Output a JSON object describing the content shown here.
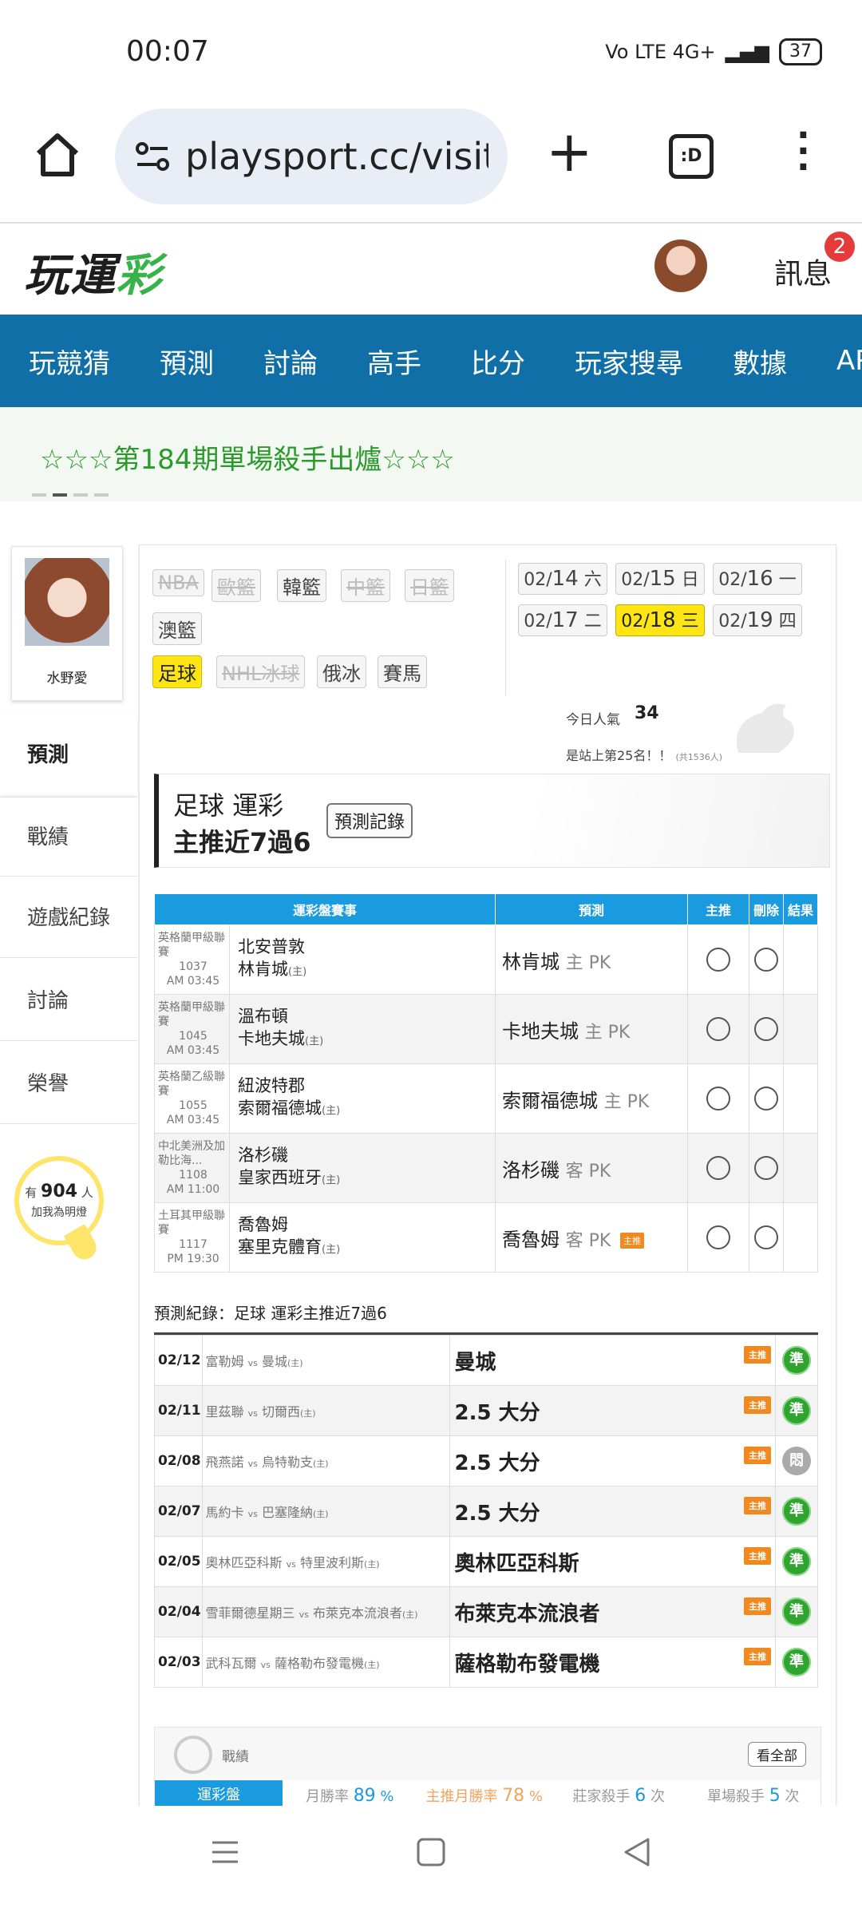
{
  "status_bar": {
    "time": "00:07",
    "network": "Vo LTE 4G+",
    "battery": "37"
  },
  "browser": {
    "url": "playsport.cc/visit",
    "tabs_label": ":D"
  },
  "site": {
    "logo_part1": "玩運",
    "logo_part2": "彩",
    "messages_label": "訊息",
    "messages_badge": "2"
  },
  "nav": [
    "玩競猜",
    "預測",
    "討論",
    "高手",
    "比分",
    "玩家搜尋",
    "數據",
    "APP"
  ],
  "banner": {
    "text": "☆☆☆第184期單場殺手出爐☆☆☆"
  },
  "sidebar": {
    "profile_name": "水野愛",
    "items": [
      "預測",
      "戰績",
      "遊戲紀錄",
      "討論",
      "榮譽"
    ],
    "bulb_prefix": "有",
    "bulb_count": "904",
    "bulb_suffix": "人",
    "bulb_line2": "加我為明燈"
  },
  "sports": {
    "row1": [
      "NBA",
      "歐籃",
      "韓籃",
      "中籃",
      "日籃"
    ],
    "row2": [
      "澳籃"
    ],
    "row3": [
      "足球",
      "NHL冰球",
      "俄冰",
      "賽馬"
    ]
  },
  "dates": [
    {
      "md": "02/",
      "d": "14",
      "w": "六"
    },
    {
      "md": "02/",
      "d": "15",
      "w": "日"
    },
    {
      "md": "02/",
      "d": "16",
      "w": "一"
    },
    {
      "md": "02/",
      "d": "17",
      "w": "二"
    },
    {
      "md": "02/",
      "d": "18",
      "w": "三"
    },
    {
      "md": "02/",
      "d": "19",
      "w": "四"
    }
  ],
  "popularity": {
    "label": "今日人氣",
    "value": "34",
    "rank": "是站上第25名！！",
    "rank_note": "(共1536人)"
  },
  "title": {
    "line1": "足球 運彩",
    "line2": "主推近7過6",
    "record_btn": "預測記錄"
  },
  "table": {
    "headers": [
      "運彩盤賽事",
      "預測",
      "主推",
      "刪除",
      "結果"
    ],
    "rows": [
      {
        "league": "英格蘭甲級聯賽",
        "no": "1037",
        "time": "AM 03:45",
        "away": "北安普敦",
        "home": "林肯城",
        "home_tag": "(主)",
        "pick": "林肯城",
        "side": "主 PK",
        "tag": ""
      },
      {
        "league": "英格蘭甲級聯賽",
        "no": "1045",
        "time": "AM 03:45",
        "away": "溫布頓",
        "home": "卡地夫城",
        "home_tag": "(主)",
        "pick": "卡地夫城",
        "side": "主 PK",
        "tag": ""
      },
      {
        "league": "英格蘭乙級聯賽",
        "no": "1055",
        "time": "AM 03:45",
        "away": "紐波特郡",
        "home": "索爾福德城",
        "home_tag": "(主)",
        "pick": "索爾福德城",
        "side": "主 PK",
        "tag": ""
      },
      {
        "league": "中北美洲及加勒比海...",
        "no": "1108",
        "time": "AM 11:00",
        "away": "洛杉磯",
        "home": "皇家西班牙",
        "home_tag": "(主)",
        "pick": "洛杉磯",
        "side": "客 PK",
        "tag": ""
      },
      {
        "league": "土耳其甲級聯賽",
        "no": "1117",
        "time": "PM 19:30",
        "away": "喬魯姆",
        "home": "塞里克體育",
        "home_tag": "(主)",
        "pick": "喬魯姆",
        "side": "客 PK",
        "tag": "主推"
      }
    ]
  },
  "record": {
    "title": "預測紀錄：足球 運彩主推近7過6",
    "vs": "vs",
    "rows": [
      {
        "date": "02/12",
        "away": "富勒姆",
        "home": "曼城",
        "home_tag": "(主)",
        "pick": "曼城",
        "tag": "主推",
        "result": "準",
        "win": true
      },
      {
        "date": "02/11",
        "away": "里茲聯",
        "home": "切爾西",
        "home_tag": "(主)",
        "pick": "2.5 大分",
        "tag": "主推",
        "result": "準",
        "win": true
      },
      {
        "date": "02/08",
        "away": "飛燕諾",
        "home": "烏特勒支",
        "home_tag": "(主)",
        "pick": "2.5 大分",
        "tag": "主推",
        "result": "悶",
        "win": false
      },
      {
        "date": "02/07",
        "away": "馬約卡",
        "home": "巴塞隆納",
        "home_tag": "(主)",
        "pick": "2.5 大分",
        "tag": "主推",
        "result": "準",
        "win": true
      },
      {
        "date": "02/05",
        "away": "奧林匹亞科斯",
        "home": "特里波利斯",
        "home_tag": "(主)",
        "pick": "奧林匹亞科斯",
        "tag": "主推",
        "result": "準",
        "win": true
      },
      {
        "date": "02/04",
        "away": "雪菲爾德星期三",
        "home": "布萊克本流浪者",
        "home_tag": "(主)",
        "pick": "布萊克本流浪者",
        "tag": "主推",
        "result": "準",
        "win": true
      },
      {
        "date": "02/03",
        "away": "武科瓦爾",
        "home": "薩格勒布發電機",
        "home_tag": "(主)",
        "pick": "薩格勒布發電機",
        "tag": "主推",
        "result": "準",
        "win": true
      }
    ]
  },
  "stats": {
    "title": "戰績",
    "see_all": "看全部",
    "tag": "運彩盤",
    "month_label": "月勝率",
    "month_val": "89",
    "pct": "%",
    "main_label": "主推月勝率",
    "main_val": "78",
    "dealer_label": "莊家殺手",
    "dealer_val": "6",
    "unit": "次",
    "single_label": "單場殺手",
    "single_val": "5"
  }
}
